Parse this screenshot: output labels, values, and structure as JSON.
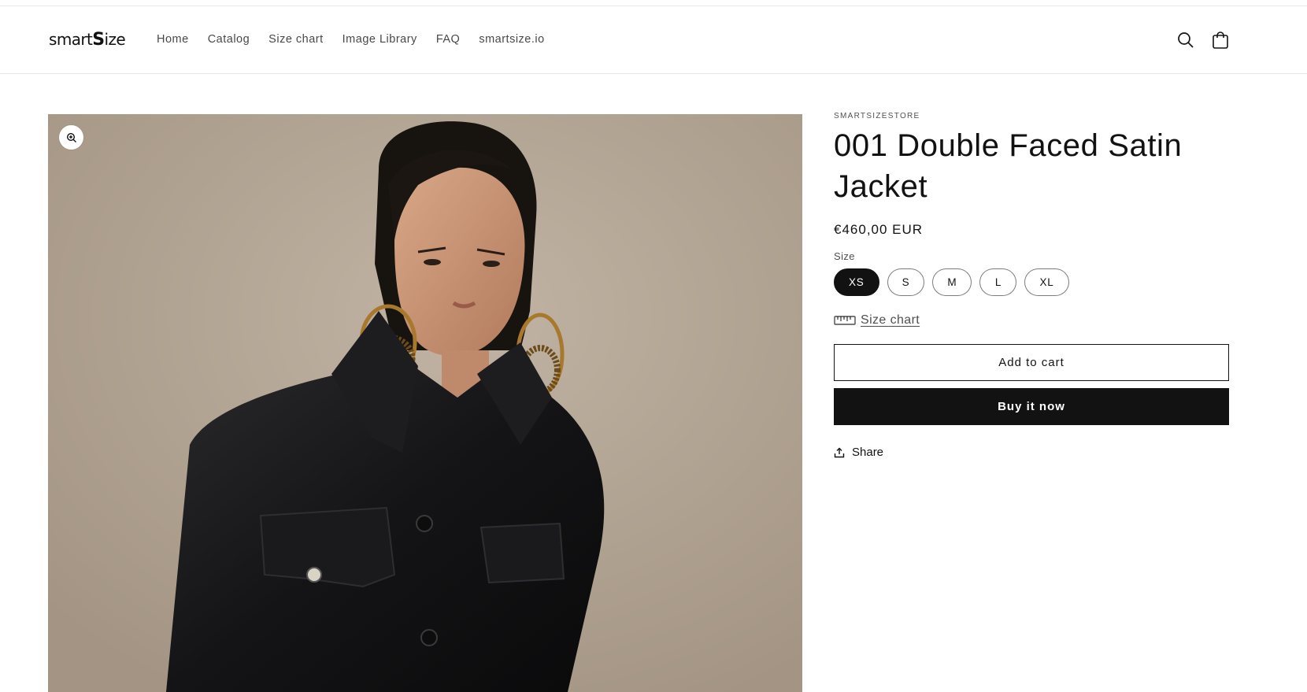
{
  "header": {
    "logo_prefix": "smart",
    "logo_bold": "S",
    "logo_suffix": "ize",
    "nav": [
      {
        "label": "Home"
      },
      {
        "label": "Catalog"
      },
      {
        "label": "Size chart"
      },
      {
        "label": "Image Library"
      },
      {
        "label": "FAQ"
      },
      {
        "label": "smartsize.io"
      }
    ],
    "icons": [
      "search-icon",
      "cart-icon"
    ]
  },
  "product": {
    "vendor": "SMARTSIZESTORE",
    "title_line1": "001 Double Faced Satin",
    "title_line2": "Jacket",
    "price": "€460,00 EUR",
    "size_label": "Size",
    "sizes": [
      "XS",
      "S",
      "M",
      "L",
      "XL"
    ],
    "selected_size": "XS",
    "size_chart_label": "Size chart",
    "add_to_cart_label": "Add to cart",
    "buy_now_label": "Buy it now",
    "share_label": "Share"
  },
  "colors": {
    "text": "#121212",
    "button_dark": "#121212",
    "photo_background": "#b3a595"
  }
}
